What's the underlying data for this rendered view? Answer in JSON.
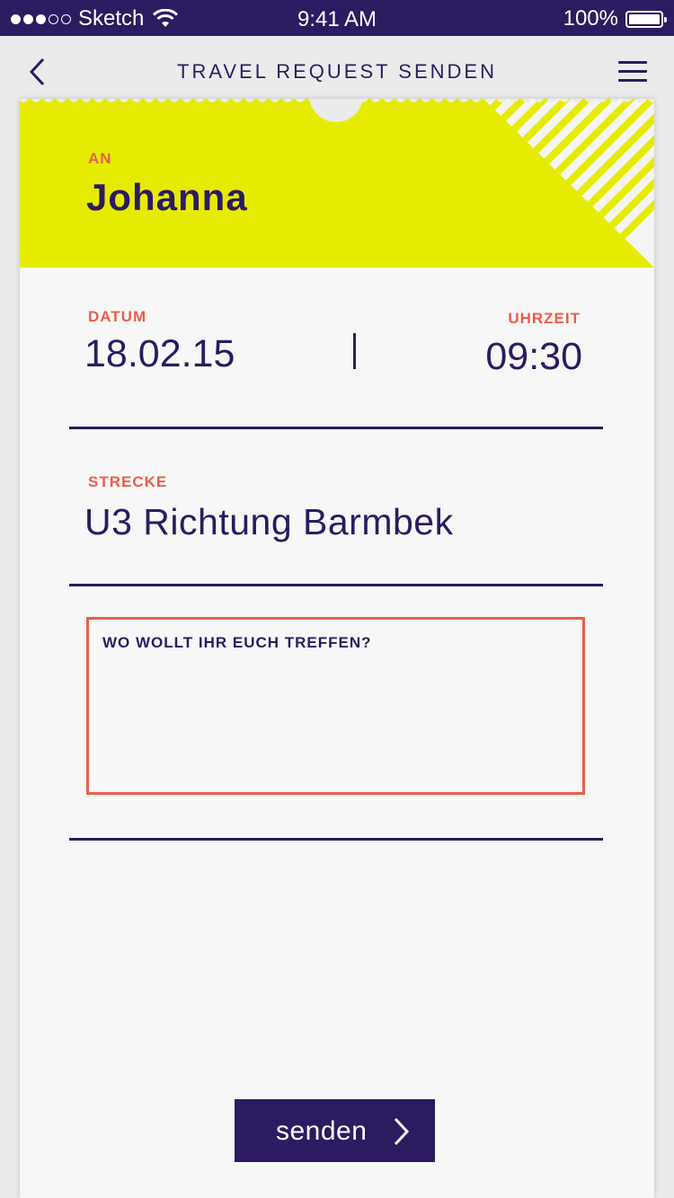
{
  "status_bar": {
    "carrier": "Sketch",
    "time": "9:41 AM",
    "battery": "100%",
    "signal_dots_filled": 3,
    "signal_dots_total": 5
  },
  "nav": {
    "title": "TRAVEL REQUEST SENDEN",
    "back_icon": "chevron-left-icon",
    "menu_icon": "hamburger-menu-icon"
  },
  "ticket": {
    "to_label": "AN",
    "to_value": "Johanna",
    "date_label": "DATUM",
    "date_value": "18.02.15",
    "time_label": "UHRZEIT",
    "time_value": "09:30",
    "route_label": "STRECKE",
    "route_value": "U3 Richtung Barmbek",
    "meeting_label": "WO WOLLT IHR EUCH TREFFEN?",
    "meeting_value": ""
  },
  "actions": {
    "send_label": "senden",
    "send_icon": "chevron-right-icon"
  },
  "colors": {
    "primary": "#2c1b60",
    "accent": "#ee5c4a",
    "highlight": "#e6ec00",
    "background": "#ebebeb",
    "card": "#f7f7f7"
  }
}
